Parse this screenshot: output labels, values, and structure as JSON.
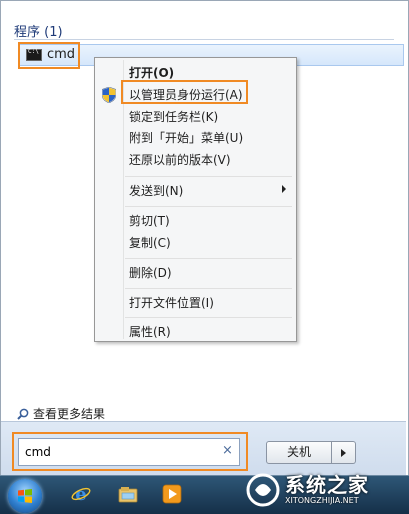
{
  "results": {
    "section_title": "程序 (1)",
    "items": [
      {
        "label": "cmd",
        "icon": "cmd-icon"
      }
    ]
  },
  "context_menu": {
    "items": [
      {
        "label": "打开(O)",
        "bold": true
      },
      {
        "label": "以管理员身份运行(A)",
        "icon": "uac-shield-icon",
        "highlighted": true
      },
      {
        "label": "锁定到任务栏(K)"
      },
      {
        "label": "附到「开始」菜单(U)"
      },
      {
        "label": "还原以前的版本(V)"
      },
      {
        "label": "发送到(N)",
        "submenu": true
      },
      {
        "label": "剪切(T)"
      },
      {
        "label": "复制(C)"
      },
      {
        "label": "删除(D)"
      },
      {
        "label": "打开文件位置(I)"
      },
      {
        "label": "属性(R)"
      }
    ]
  },
  "more_results": {
    "label": "查看更多结果",
    "icon": "magnifier-icon"
  },
  "search": {
    "value": "cmd",
    "clear_icon": "×"
  },
  "shutdown": {
    "label": "关机"
  },
  "taskbar": {
    "icons": [
      "start-orb",
      "internet-explorer-icon",
      "windows-explorer-icon",
      "media-player-icon"
    ]
  },
  "watermark": {
    "text": "系统之家",
    "subtext": "XITONGZHIJIA.NET"
  },
  "colors": {
    "highlight_box": "#f08a24",
    "selection_bg": "#dbe9fb",
    "section_title": "#1e3a78"
  }
}
